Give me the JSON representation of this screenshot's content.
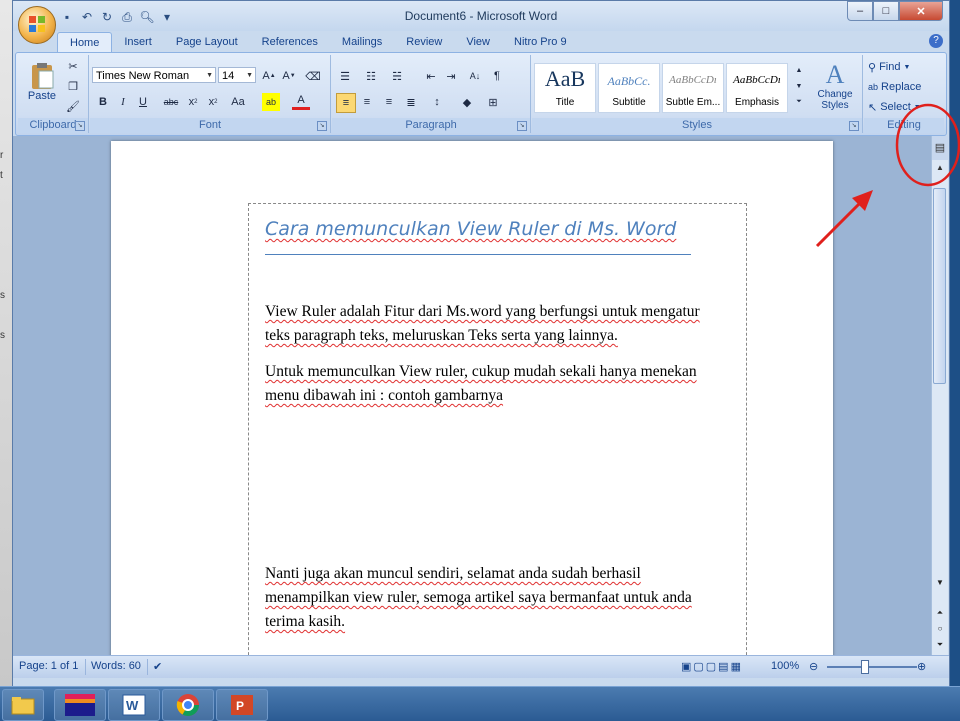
{
  "window": {
    "title": "Document6 - Microsoft Word",
    "controls": {
      "minimize": "–",
      "maximize": "□",
      "close": "✕"
    }
  },
  "tabs": [
    "Home",
    "Insert",
    "Page Layout",
    "References",
    "Mailings",
    "Review",
    "View",
    "Nitro Pro 9"
  ],
  "ribbon": {
    "clipboard": {
      "label": "Clipboard",
      "paste": "Paste"
    },
    "font": {
      "label": "Font",
      "font_name": "Times New Roman",
      "font_size": "14"
    },
    "paragraph": {
      "label": "Paragraph"
    },
    "styles": {
      "label": "Styles",
      "tiles": [
        {
          "preview": "AaB",
          "name": "Title"
        },
        {
          "preview": "AaBbCc.",
          "name": "Subtitle"
        },
        {
          "preview": "AaBbCcDı",
          "name": "Subtle Em..."
        },
        {
          "preview": "AaBbCcDı",
          "name": "Emphasis"
        }
      ],
      "change_styles": "Change Styles"
    },
    "editing": {
      "label": "Editing",
      "find": "Find",
      "replace": "Replace",
      "select": "Select"
    }
  },
  "document": {
    "title": "Cara memunculkan  View Ruler di Ms. Word",
    "para1_line1": "View Ruler adalah Fitur dari Ms.word yang berfungsi untuk mengatur",
    "para1_line2": "teks paragraph teks, meluruskan Teks serta yang lainnya.",
    "para2_line1": "Untuk memunculkan View ruler, cukup mudah sekali hanya menekan",
    "para2_line2": "menu dibawah ini : contoh gambarnya",
    "para3_line1": "Nanti juga akan  muncul sendiri, selamat anda sudah berhasil",
    "para3_line2": "menampilkan view ruler, semoga artikel saya bermanfaat untuk anda",
    "para3_line3": "terima kasih."
  },
  "status": {
    "page": "Page: 1 of 1",
    "words": "Words: 60",
    "zoom": "100%"
  },
  "colors": {
    "annotation": "#e0201c",
    "heading": "#4f81bd"
  }
}
